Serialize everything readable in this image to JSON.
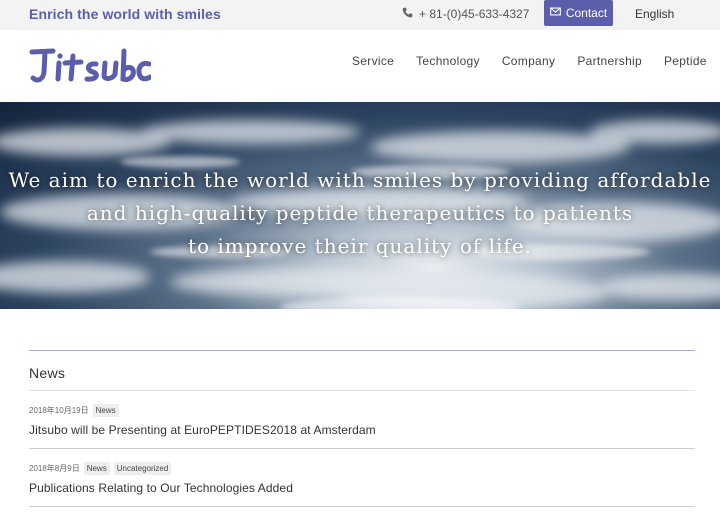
{
  "topbar": {
    "tagline": "Enrich the world with smiles",
    "phone": "+ 81-(0)45-633-4327",
    "contact_label": "Contact",
    "language": "English"
  },
  "header": {
    "logo_text": "Jitsubo",
    "nav": [
      "Service",
      "Technology",
      "Company",
      "Partnership",
      "Peptide"
    ]
  },
  "hero": {
    "line1": "We aim to enrich the world with smiles by providing affordable",
    "line2": "and high-quality peptide therapeutics to patients",
    "line3": "to improve their quality of life."
  },
  "news": {
    "title": "News",
    "items": [
      {
        "date": "2018年10月19日",
        "tags": [
          "News"
        ],
        "title": "Jitsubo will be Presenting at EuroPEPTIDES2018 at Amsterdam"
      },
      {
        "date": "2018年8月9日",
        "tags": [
          "News",
          "Uncategorized"
        ],
        "title": "Publications Relating to Our Technologies Added"
      }
    ]
  },
  "colors": {
    "accent": "#5b5eab",
    "topbar_bg": "#f3f3f3"
  }
}
